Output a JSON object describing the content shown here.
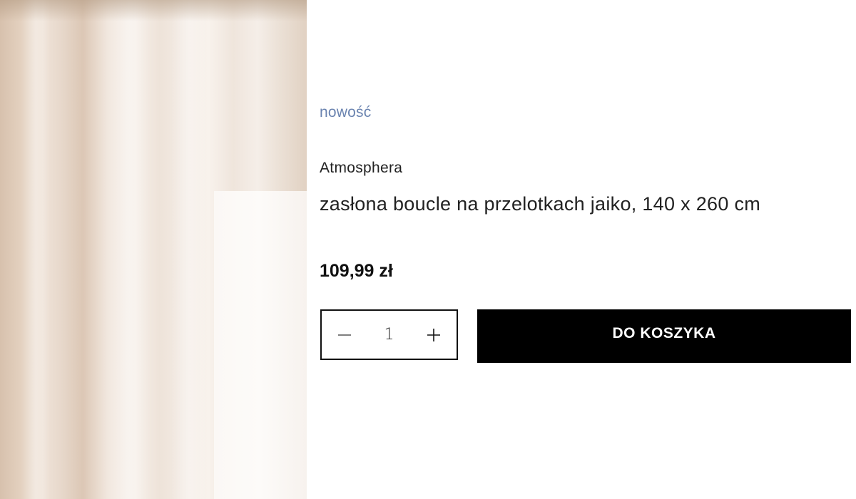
{
  "product": {
    "image_alt": "product-image",
    "badge": "nowość",
    "brand": "Atmosphera",
    "title": "zasłona boucle na przelotkach jaiko, 140 x 260 cm",
    "price": "109,99 zł"
  },
  "quantity": {
    "value": "1",
    "decrement_icon": "minus-icon",
    "increment_icon": "plus-icon"
  },
  "cart": {
    "button_label": "DO KOSZYKA"
  },
  "colors": {
    "badge": "#6b84b0",
    "button_bg": "#000000",
    "button_text": "#ffffff",
    "text": "#222222"
  }
}
